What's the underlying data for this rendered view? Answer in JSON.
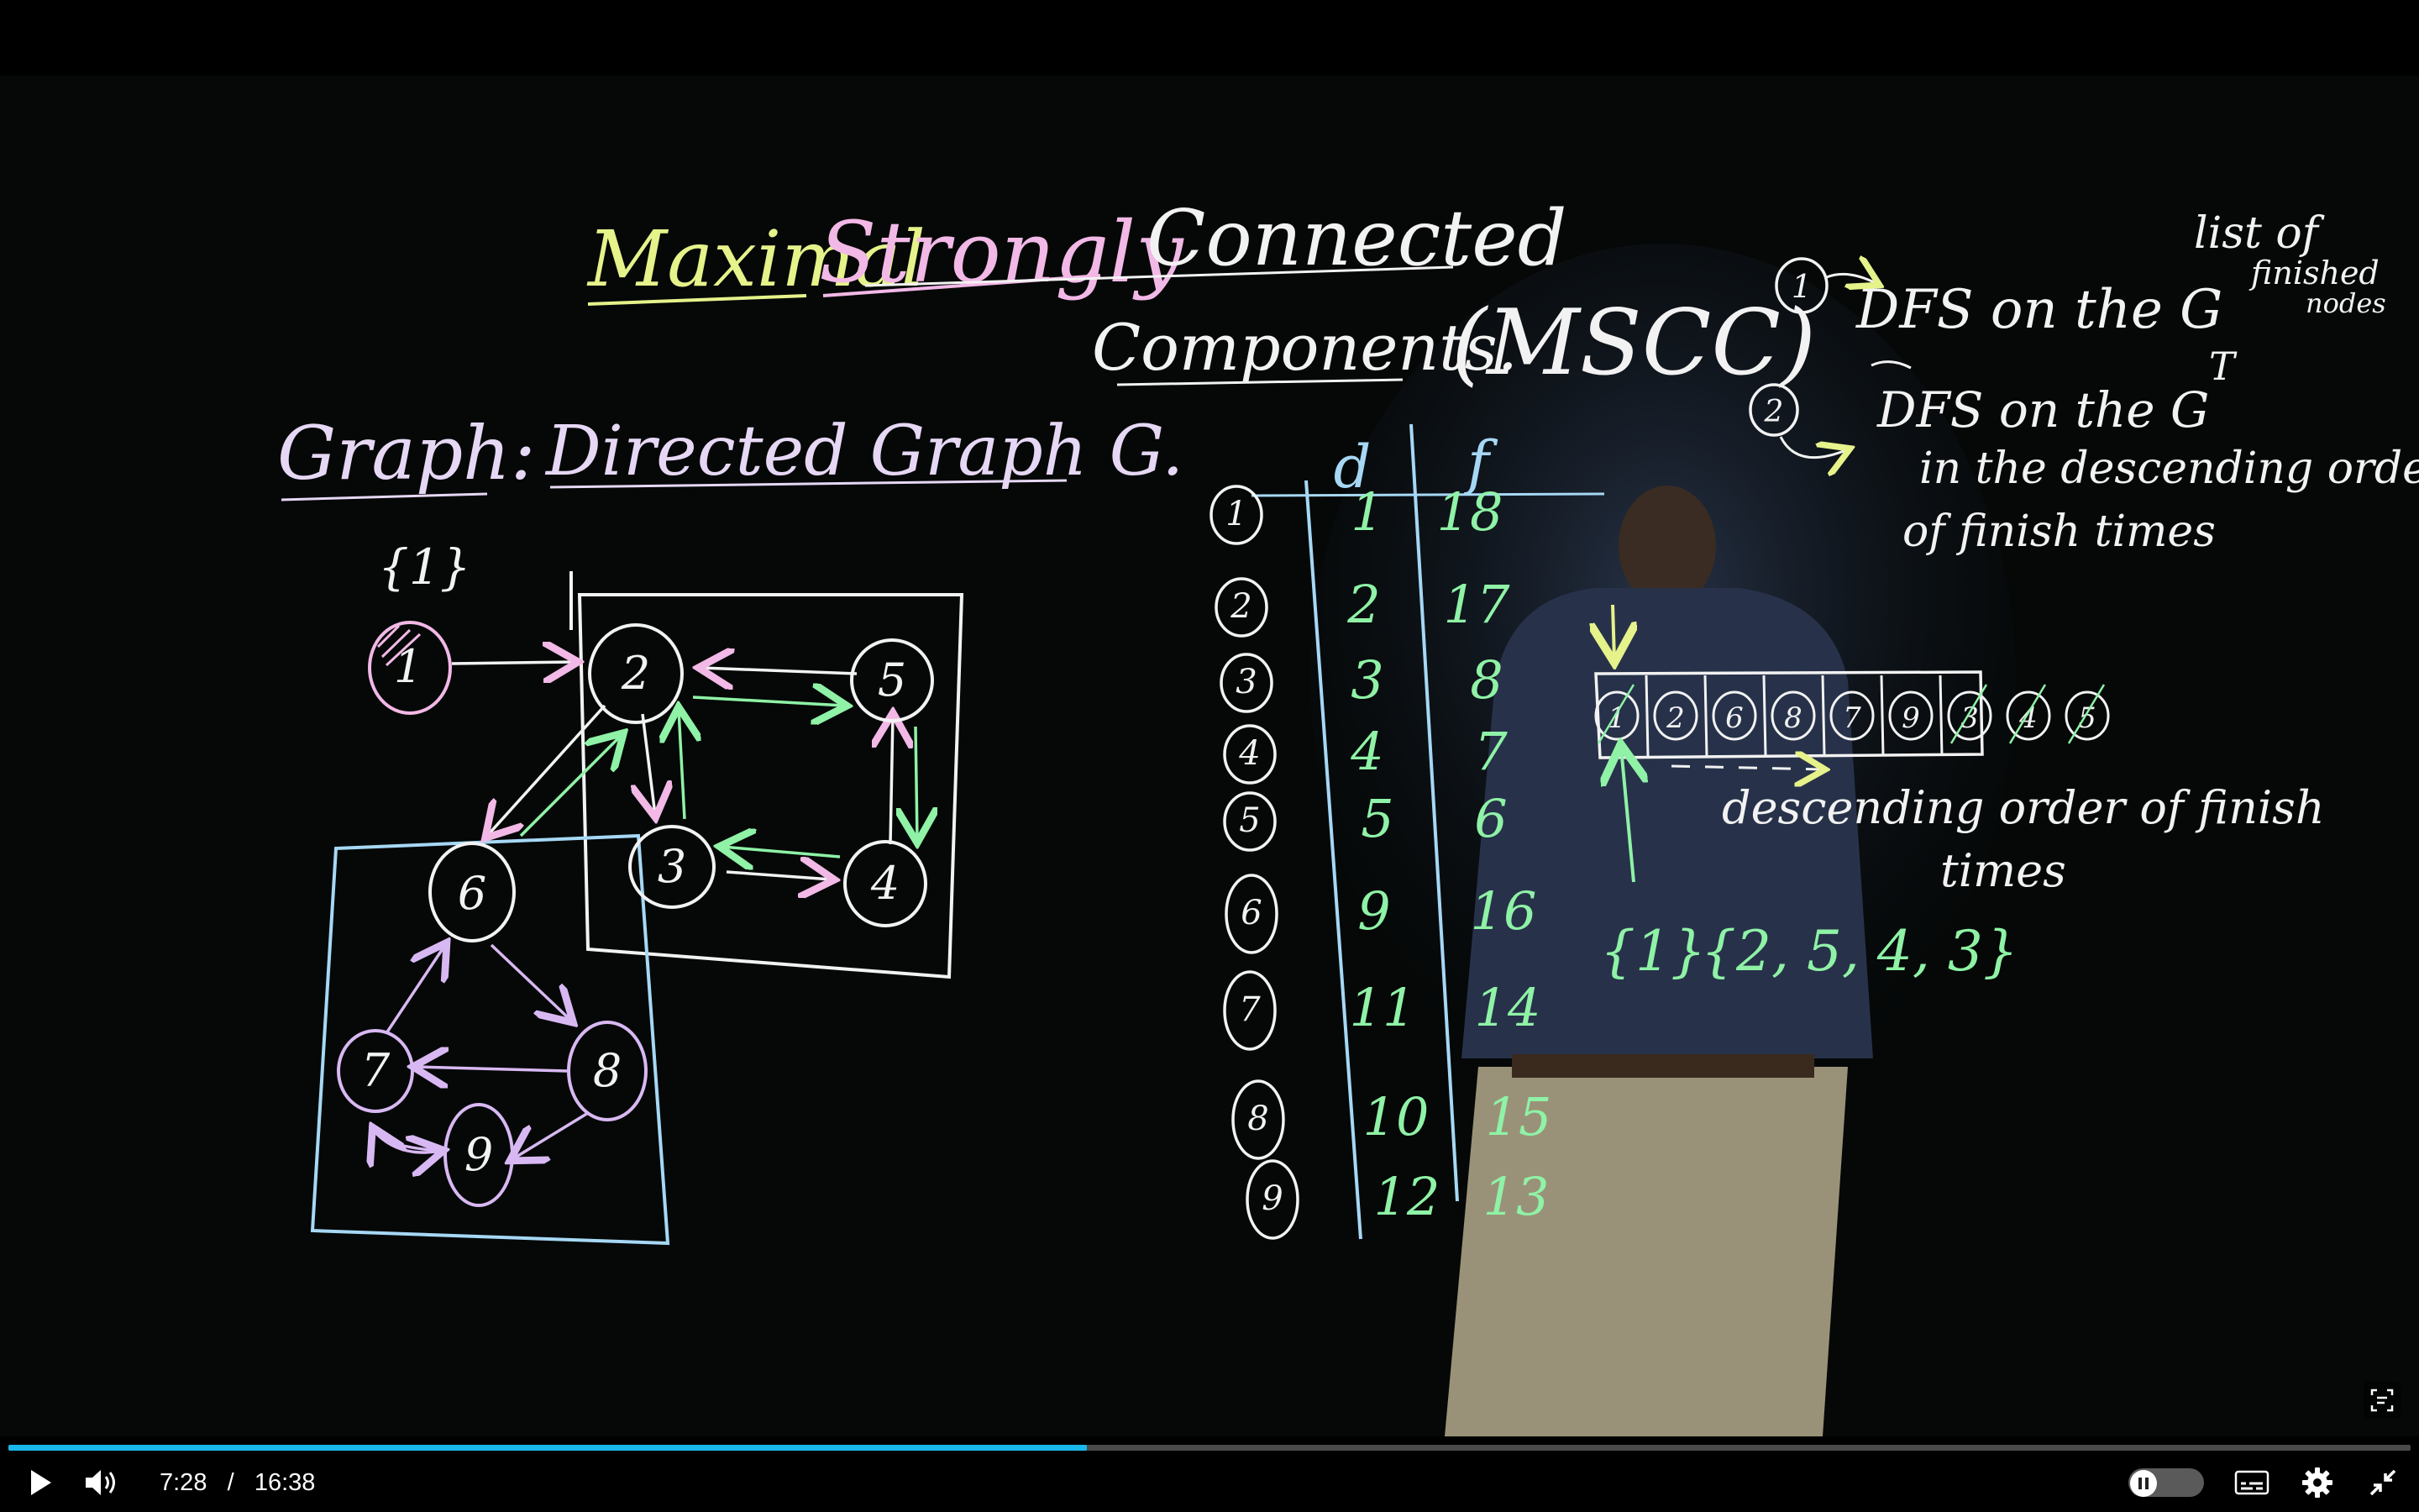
{
  "board": {
    "title_line1_a": "Maximal",
    "title_line1_b": "Strongly",
    "title_line1_c": "Connected",
    "title_line2": "Components.",
    "title_abbrev": "(MSCC)",
    "graph_label": "Graph:",
    "graph_desc": "Directed Graph G.",
    "set_1": "{1}",
    "step1_num": "1",
    "step1_text": "DFS on the G",
    "step1_note_a": "list of",
    "step1_note_b": "finished",
    "step1_note_c": "nodes",
    "step2_num": "2",
    "step2_text": "DFS on the G",
    "step2_sup": "T",
    "step2_line2": "in the descending order",
    "step2_line3": "of finish times",
    "order_label_1": "descending order of finish",
    "order_label_2": "times",
    "scc_set_1": "{1}",
    "scc_set_2": "{2, 5, 4, 3}",
    "table_header_d": "d",
    "table_header_f": "f",
    "nodes": [
      "1",
      "2",
      "3",
      "4",
      "5",
      "6",
      "7",
      "8",
      "9"
    ],
    "d_values": [
      "1",
      "2",
      "3",
      "4",
      "5",
      "9",
      "11",
      "10",
      "12"
    ],
    "f_values": [
      "18",
      "17",
      "8",
      "7",
      "6",
      "16",
      "14",
      "15",
      "13"
    ],
    "stack_cells": [
      "1",
      "2",
      "6",
      "8",
      "7",
      "9",
      "3",
      "4",
      "5"
    ]
  },
  "controls": {
    "current_time": "7:28",
    "separator": "/",
    "duration": "16:38",
    "progress": 0.449,
    "icons": {
      "play": "play-icon",
      "volume": "volume-icon",
      "captions": "captions-icon",
      "settings": "gear-icon",
      "fullscreen": "exit-fullscreen-icon",
      "transcript": "transcript-icon"
    }
  },
  "colors": {
    "progress": "#1ab7ea",
    "chalk_yellow": "#e6f28a",
    "chalk_pink": "#f2b8e6",
    "chalk_blue": "#a6d8f5",
    "chalk_green": "#8ff2a6",
    "chalk_purple": "#d8b8f2"
  }
}
